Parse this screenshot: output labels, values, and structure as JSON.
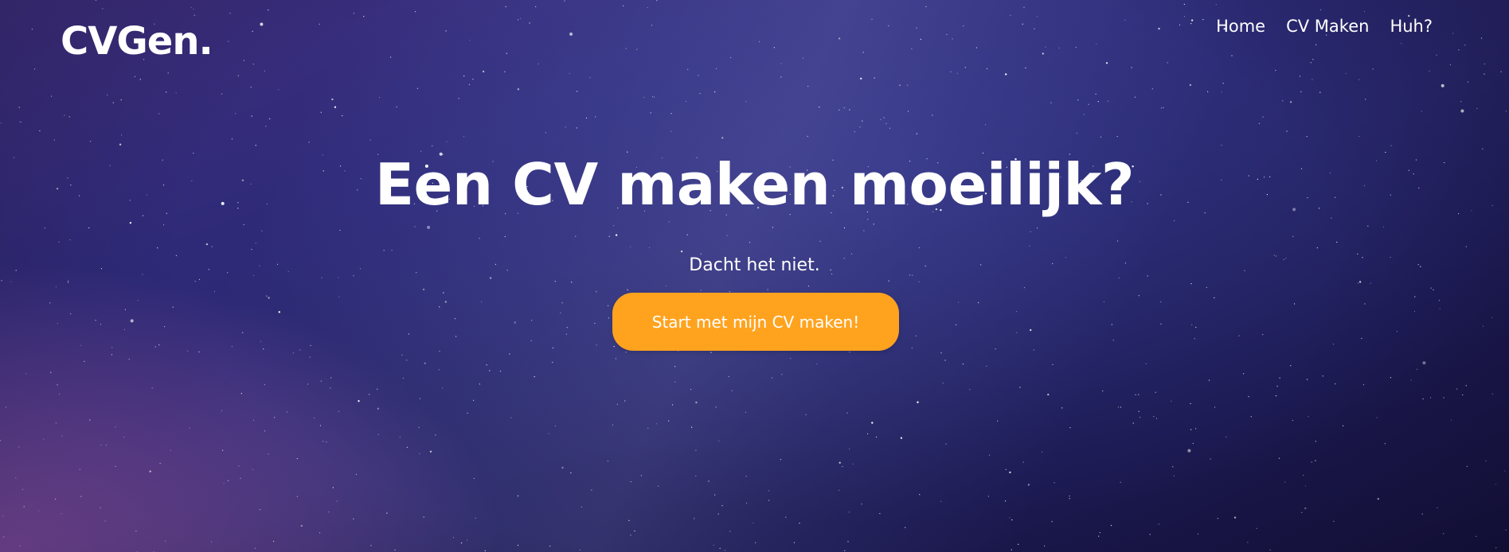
{
  "brand": {
    "logo_text": "CVGen."
  },
  "nav": {
    "items": [
      {
        "label": "Home"
      },
      {
        "label": "CV Maken"
      },
      {
        "label": "Huh?"
      }
    ]
  },
  "hero": {
    "headline": "Een CV maken moeilijk?",
    "subline": "Dacht het niet.",
    "cta_label": "Start met mijn CV maken!"
  },
  "colors": {
    "cta_background": "#ffa31f",
    "text": "#ffffff",
    "sky_dark": "#1c1a52",
    "sky_purple": "#a55fb9"
  }
}
